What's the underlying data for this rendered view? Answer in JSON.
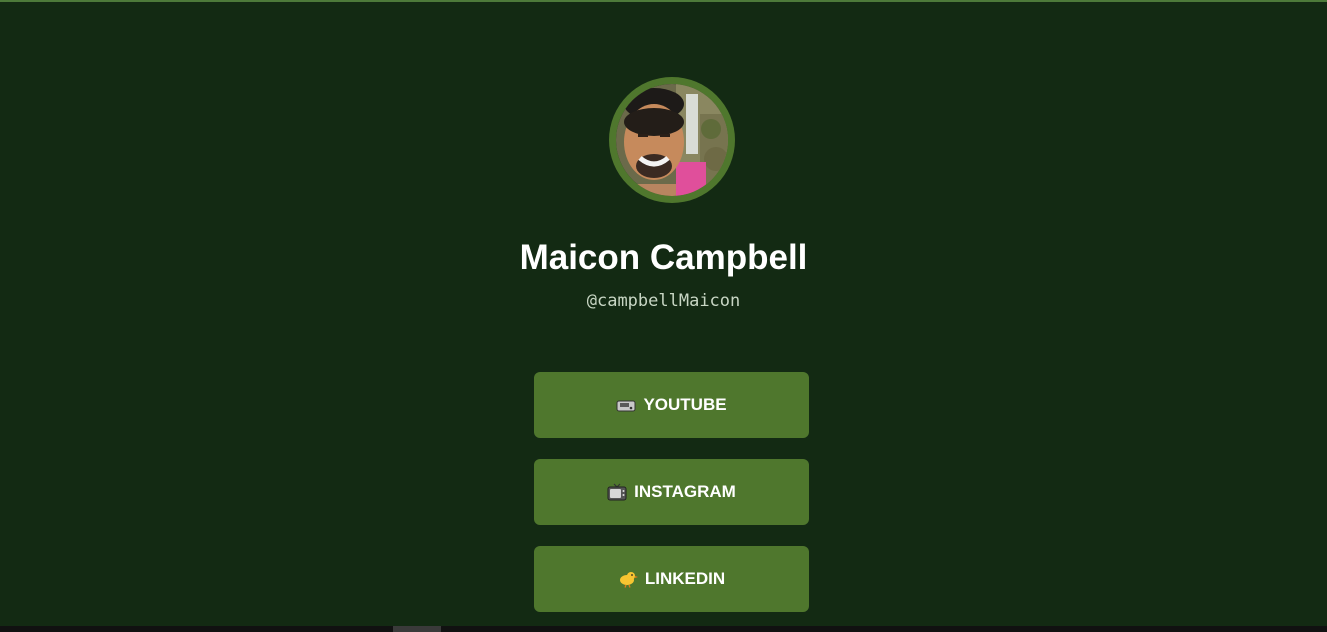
{
  "profile": {
    "name": "Maicon Campbell",
    "handle": "@campbellMaicon"
  },
  "links": [
    {
      "icon": "pager-icon",
      "label": "YOUTUBE"
    },
    {
      "icon": "television-icon",
      "label": "INSTAGRAM"
    },
    {
      "icon": "baby-chick-icon",
      "label": "LINKEDIN"
    }
  ],
  "colors": {
    "background": "#132a13",
    "accent": "#4f772d",
    "text": "#ffffff",
    "handle_text": "#c8d6c4"
  }
}
